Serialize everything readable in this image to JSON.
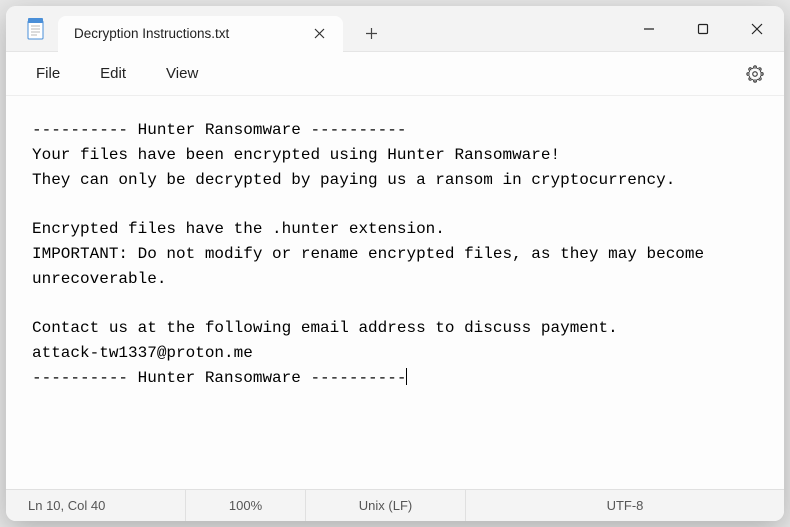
{
  "titlebar": {
    "tab_title": "Decryption Instructions.txt"
  },
  "menubar": {
    "file": "File",
    "edit": "Edit",
    "view": "View"
  },
  "document": {
    "text": "---------- Hunter Ransomware ----------\nYour files have been encrypted using Hunter Ransomware!\nThey can only be decrypted by paying us a ransom in cryptocurrency.\n\nEncrypted files have the .hunter extension.\nIMPORTANT: Do not modify or rename encrypted files, as they may become unrecoverable.\n\nContact us at the following email address to discuss payment.\nattack-tw1337@proton.me\n---------- Hunter Ransomware ----------"
  },
  "statusbar": {
    "position": "Ln 10, Col 40",
    "zoom": "100%",
    "eol": "Unix (LF)",
    "encoding": "UTF-8"
  }
}
